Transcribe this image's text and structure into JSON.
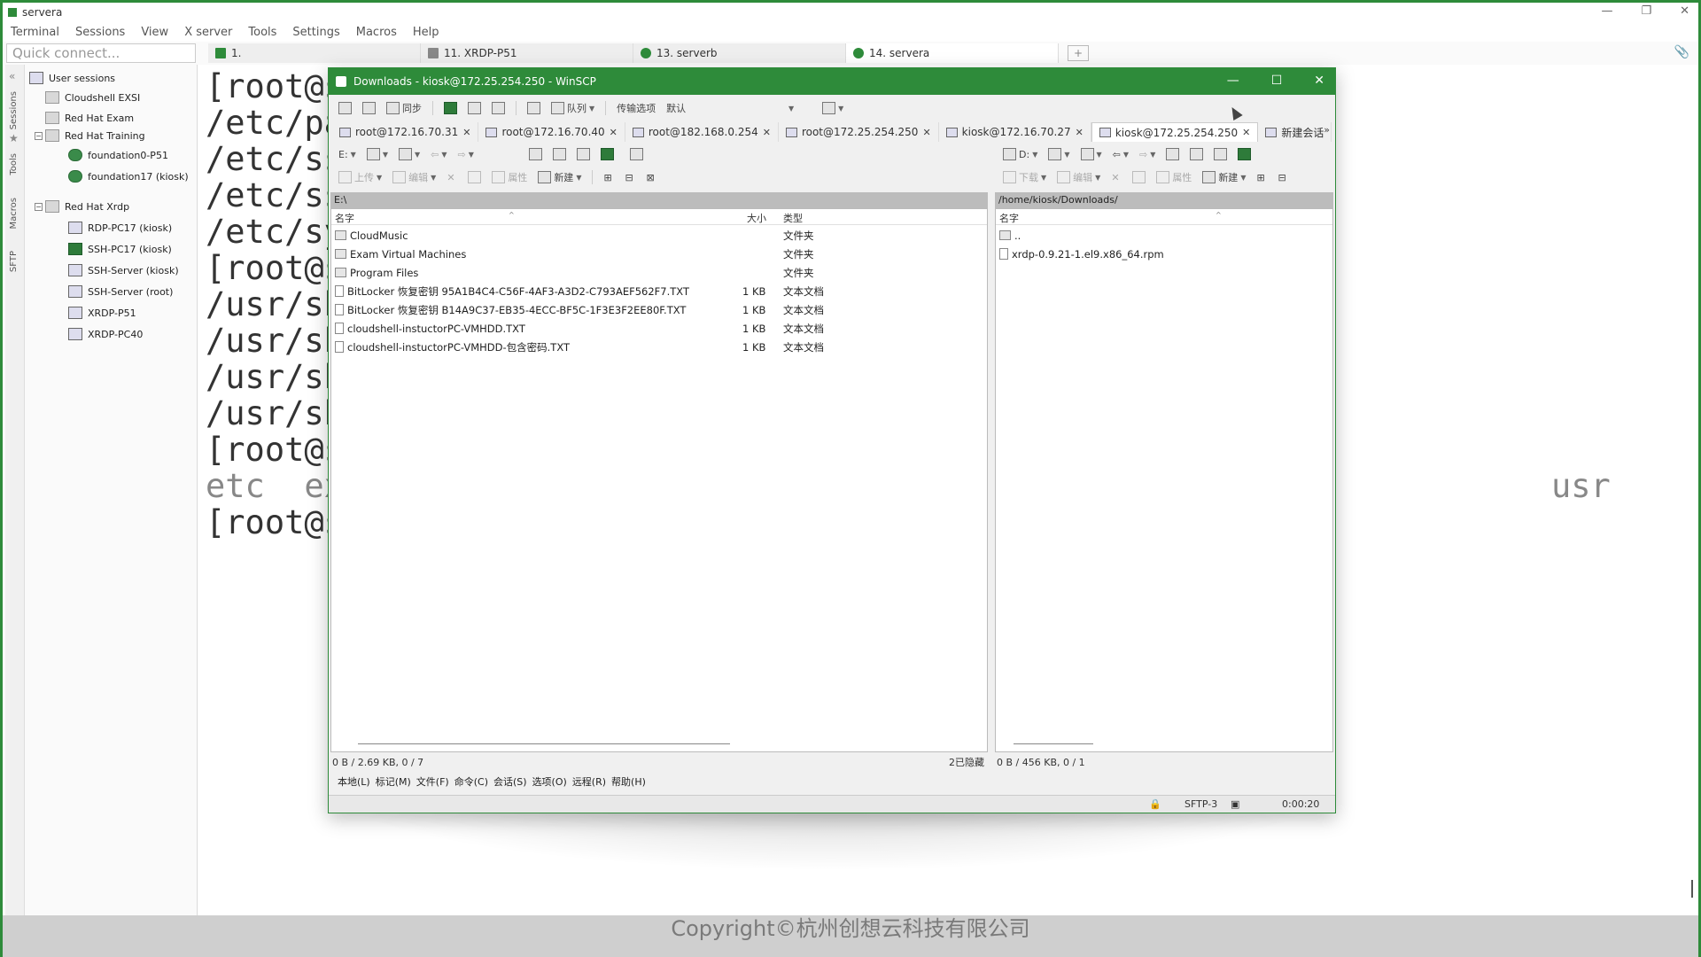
{
  "app": {
    "title": "servera"
  },
  "menu": [
    "Terminal",
    "Sessions",
    "View",
    "X server",
    "Tools",
    "Settings",
    "Macros",
    "Help"
  ],
  "quick_connect": {
    "placeholder": "Quick connect..."
  },
  "tabs": [
    {
      "label": "1."
    },
    {
      "label": "11. XRDP-P51"
    },
    {
      "label": "13. serverb"
    },
    {
      "label": "14. servera"
    }
  ],
  "side_labels": [
    "Sessions",
    "Tools",
    "Macros",
    "SFTP"
  ],
  "tree": {
    "root": "User sessions",
    "items": [
      {
        "label": "Cloudshell EXSI"
      },
      {
        "label": "Red Hat Exam"
      },
      {
        "label": "Red Hat Training"
      },
      {
        "label": "foundation0-P51"
      },
      {
        "label": "foundation17 (kiosk)"
      },
      {
        "label": "Red Hat Xrdp"
      },
      {
        "label": "RDP-PC17 (kiosk)"
      },
      {
        "label": "SSH-PC17 (kiosk)"
      },
      {
        "label": "SSH-Server (kiosk)"
      },
      {
        "label": "SSH-Server (root)"
      },
      {
        "label": "XRDP-P51"
      },
      {
        "label": "XRDP-PC40"
      }
    ]
  },
  "terminal": {
    "lines": [
      "[root@s",
      "/etc/pa",
      "/etc/ss",
      "/etc/ss",
      "/etc/sy",
      "[root@s",
      "/usr/sb",
      "/usr/sb",
      "/usr/sb",
      "/usr/sb",
      "[root@s",
      "etc  ex",
      "[root@s"
    ],
    "usr_fragment": "usr"
  },
  "winscp": {
    "title": "Downloads - kiosk@172.25.254.250 - WinSCP",
    "toolbar": {
      "sync": "同步",
      "queue": "队列",
      "transfer_label": "传输选项",
      "transfer_value": "默认"
    },
    "session_tabs": [
      {
        "label": "root@172.16.70.31"
      },
      {
        "label": "root@172.16.70.40"
      },
      {
        "label": "root@182.168.0.254"
      },
      {
        "label": "root@172.25.254.250"
      },
      {
        "label": "kiosk@172.16.70.27"
      },
      {
        "label": "kiosk@172.25.254.250"
      }
    ],
    "new_session": "新建会话",
    "left": {
      "drive": "E:",
      "upload": "上传",
      "edit": "编辑",
      "props": "属性",
      "new": "新建",
      "path": "E:\\",
      "col_name": "名字",
      "col_size": "大小",
      "col_type": "类型",
      "files": [
        {
          "name": "CloudMusic",
          "size": "",
          "type": "文件夹",
          "kind": "folder"
        },
        {
          "name": "Exam Virtual Machines",
          "size": "",
          "type": "文件夹",
          "kind": "folder"
        },
        {
          "name": "Program Files",
          "size": "",
          "type": "文件夹",
          "kind": "folder"
        },
        {
          "name": "BitLocker 恢复密钥 95A1B4C4-C56F-4AF3-A3D2-C793AEF562F7.TXT",
          "size": "1 KB",
          "type": "文本文档",
          "kind": "doc"
        },
        {
          "name": "BitLocker 恢复密钥 B14A9C37-EB35-4ECC-BF5C-1F3E3F2EE80F.TXT",
          "size": "1 KB",
          "type": "文本文档",
          "kind": "doc"
        },
        {
          "name": "cloudshell-instuctorPC-VMHDD.TXT",
          "size": "1 KB",
          "type": "文本文档",
          "kind": "doc"
        },
        {
          "name": "cloudshell-instuctorPC-VMHDD-包含密码.TXT",
          "size": "1 KB",
          "type": "文本文档",
          "kind": "doc"
        }
      ],
      "status": "0 B / 2.69 KB,  0 / 7",
      "hidden": "2已隐藏"
    },
    "right": {
      "drive": "D:",
      "download": "下载",
      "edit": "编辑",
      "props": "属性",
      "new": "新建",
      "path": "/home/kiosk/Downloads/",
      "col_name": "名字",
      "parent": "..",
      "files": [
        {
          "name": "xrdp-0.9.21-1.el9.x86_64.rpm"
        }
      ],
      "status": "0 B / 456 KB,  0 / 1"
    },
    "bottom_menu": [
      "本地(L)",
      "标记(M)",
      "文件(F)",
      "命令(C)",
      "会话(S)",
      "选项(O)",
      "远程(R)",
      "帮助(H)"
    ],
    "statusbar": {
      "protocol": "SFTP-3",
      "time": "0:00:20"
    }
  },
  "copyright": "Copyright©杭州创想云科技有限公司",
  "colors": {
    "accent": "#2e8b3a"
  }
}
